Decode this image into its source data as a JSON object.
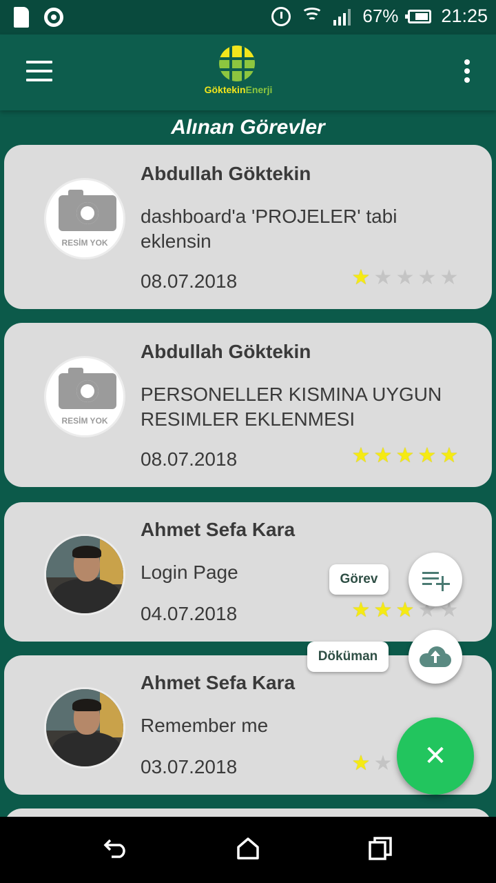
{
  "status_bar": {
    "battery": "67%",
    "time": "21:25"
  },
  "app": {
    "logo_part1": "Göktekin",
    "logo_part2": "Enerji"
  },
  "page_title": "Alınan Görevler",
  "tasks": [
    {
      "name": "Abdullah Göktekin",
      "description": "dashboard'a 'PROJELER' tabi eklensin",
      "date": "08.07.2018",
      "rating": 1,
      "avatar": "placeholder",
      "placeholder_text": "RESİM YOK"
    },
    {
      "name": "Abdullah Göktekin",
      "description": "PERSONELLER KISMINA UYGUN RESIMLER EKLENMESI",
      "date": "08.07.2018",
      "rating": 5,
      "avatar": "placeholder",
      "placeholder_text": "RESİM YOK"
    },
    {
      "name": "Ahmet Sefa Kara",
      "description": "Login Page",
      "date": "04.07.2018",
      "rating": 3,
      "avatar": "photo"
    },
    {
      "name": "Ahmet Sefa Kara",
      "description": "Remember me",
      "date": "03.07.2018",
      "rating": 1,
      "avatar": "photo"
    }
  ],
  "fab_menu": {
    "gorev_label": "Görev",
    "dokuman_label": "Döküman"
  },
  "icons": {
    "menu": "hamburger-menu-icon",
    "overflow": "more-vert-icon",
    "gorev": "playlist-add-icon",
    "dokuman": "cloud-upload-icon",
    "fab": "close-icon",
    "back": "back-icon",
    "home": "home-icon",
    "recents": "recents-icon"
  },
  "colors": {
    "appbar": "#0d5d4d",
    "background": "#0c5a4a",
    "card": "#dcdcdc",
    "fab": "#22c55e",
    "star_on": "#f5ea14",
    "star_off": "#c4c4c4"
  }
}
